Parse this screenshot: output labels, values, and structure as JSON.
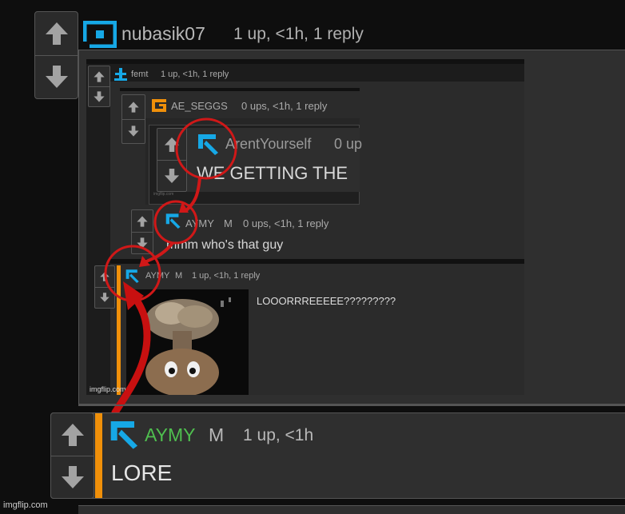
{
  "watermark": "imgflip.com",
  "top_comment": {
    "username": "nubasik07",
    "meta": "1 up, <1h, 1 reply"
  },
  "embedded_image": {
    "watermark": "imgflip.com",
    "tiny_watermark": "imgflip.com",
    "c_femt": {
      "username": "femt",
      "meta": "1 up, <1h, 1 reply"
    },
    "c_aeseggs": {
      "username": "AE_SEGGS",
      "meta": "0 ups, <1h, 1 reply"
    },
    "c_arent": {
      "username": "ArentYourself",
      "meta": "0 up",
      "text": "WE GETTING THE"
    },
    "c_aymy1": {
      "username": "AYMY",
      "gender": "M",
      "meta": "0 ups, <1h, 1 reply",
      "text": "mmm who's that guy"
    },
    "c_aymy2": {
      "username": "AYMY",
      "gender": "M",
      "meta": "1 up, <1h, 1 reply",
      "text": "LOOORRREEEEE?????????"
    }
  },
  "bottom_comment": {
    "username": "AYMY",
    "gender": "M",
    "meta": "1 up, <1h",
    "text": "LORE"
  },
  "colors": {
    "accent_blue": "#16a8e6",
    "accent_orange": "#f0900a",
    "username_green": "#4fbf4f",
    "annotation_red": "#d01818"
  }
}
